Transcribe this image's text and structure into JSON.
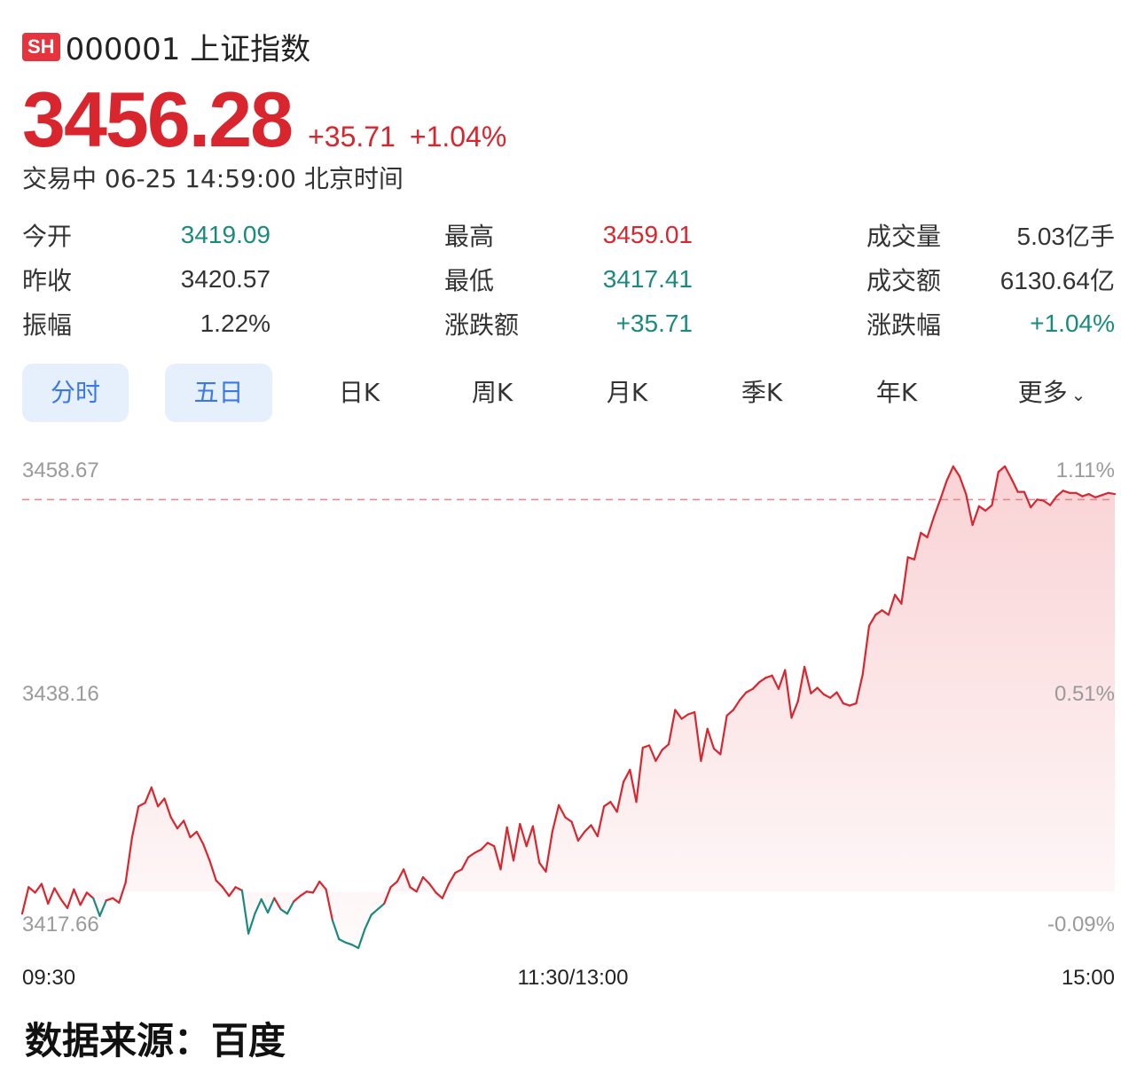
{
  "header": {
    "exchange_badge": "SH",
    "code_name": "000001 上证指数"
  },
  "quote": {
    "price": "3456.28",
    "change": "+35.71",
    "change_pct": "+1.04%"
  },
  "status_line": "交易中 06-25 14:59:00 北京时间",
  "stats": [
    [
      {
        "label": "今开",
        "value": "3419.09",
        "tone": "down"
      },
      {
        "label": "最高",
        "value": "3459.01",
        "tone": "up"
      },
      {
        "label": "成交量",
        "value": "5.03亿手",
        "tone": "flat"
      }
    ],
    [
      {
        "label": "昨收",
        "value": "3420.57",
        "tone": "flat"
      },
      {
        "label": "最低",
        "value": "3417.41",
        "tone": "down"
      },
      {
        "label": "成交额",
        "value": "6130.64亿",
        "tone": "flat"
      }
    ],
    [
      {
        "label": "振幅",
        "value": "1.22%",
        "tone": "flat"
      },
      {
        "label": "涨跌额",
        "value": "+35.71",
        "tone": "down"
      },
      {
        "label": "涨跌幅",
        "value": "+1.04%",
        "tone": "down"
      }
    ]
  ],
  "tabs": [
    {
      "label": "分时",
      "active": true
    },
    {
      "label": "五日",
      "active": true
    },
    {
      "label": "日K",
      "active": false
    },
    {
      "label": "周K",
      "active": false
    },
    {
      "label": "月K",
      "active": false
    },
    {
      "label": "季K",
      "active": false
    },
    {
      "label": "年K",
      "active": false
    },
    {
      "label": "更多",
      "active": false
    }
  ],
  "colors": {
    "up": "#d9262e",
    "down": "#1a8a7e",
    "accent": "#3b77e6"
  },
  "chart_data": {
    "type": "line",
    "y_left_ticks": [
      "3458.67",
      "3438.16",
      "3417.66"
    ],
    "y_right_ticks": [
      "1.11%",
      "0.51%",
      "-0.09%"
    ],
    "x_ticks": [
      "09:30",
      "11:30/13:00",
      "15:00"
    ],
    "ylim": [
      3417.66,
      3458.67
    ],
    "prev_close": 3420.57,
    "reference_line": 3456.0,
    "series": [
      {
        "values": [
          3418.6,
          3421.0,
          3420.5,
          3421.3,
          3419.5,
          3420.9,
          3419.9,
          3419.1,
          3420.8,
          3419.4,
          3420.5,
          3420.0,
          3418.4,
          3419.8,
          3420.0,
          3419.6,
          3421.4,
          3425.5,
          3428.3,
          3428.6,
          3430.0,
          3428.3,
          3429.0,
          3427.3,
          3426.3,
          3427.0,
          3425.5,
          3426.0,
          3424.9,
          3423.4,
          3421.6,
          3421.0,
          3420.2,
          3421.0,
          3420.7,
          3416.8,
          3418.6,
          3419.9,
          3418.7,
          3420.0,
          3419.0,
          3418.6,
          3419.7,
          3420.2,
          3420.6,
          3420.5,
          3421.5,
          3420.8,
          3418.0,
          3416.3,
          3416.0,
          3415.8,
          3415.5,
          3417.2,
          3418.5,
          3419.0,
          3419.5,
          3421.0,
          3421.5,
          3422.6,
          3421.0,
          3420.6,
          3421.9,
          3421.3,
          3420.5,
          3420.0,
          3421.3,
          3422.3,
          3422.6,
          3423.7,
          3424.1,
          3424.4,
          3425.0,
          3424.7,
          3422.6,
          3426.4,
          3423.4,
          3426.7,
          3424.7,
          3426.5,
          3423.2,
          3422.4,
          3426.0,
          3428.4,
          3427.3,
          3426.9,
          3425.2,
          3426.0,
          3426.6,
          3425.6,
          3428.3,
          3428.7,
          3427.8,
          3430.5,
          3431.6,
          3428.7,
          3433.6,
          3433.8,
          3432.4,
          3433.4,
          3433.9,
          3437.0,
          3436.2,
          3436.6,
          3436.8,
          3432.4,
          3435.3,
          3433.5,
          3433.0,
          3436.5,
          3437.0,
          3437.9,
          3438.6,
          3438.9,
          3439.5,
          3439.9,
          3440.1,
          3438.9,
          3440.6,
          3436.3,
          3437.8,
          3440.9,
          3438.5,
          3439.0,
          3438.4,
          3438.1,
          3438.6,
          3437.6,
          3437.4,
          3437.6,
          3440.2,
          3444.6,
          3445.6,
          3446.0,
          3445.6,
          3447.4,
          3446.6,
          3450.8,
          3450.6,
          3453.0,
          3452.6,
          3454.4,
          3456.0,
          3457.7,
          3459.0,
          3458.1,
          3456.5,
          3453.7,
          3455.4,
          3455.0,
          3455.5,
          3458.5,
          3459.0,
          3457.9,
          3456.7,
          3456.7,
          3455.3,
          3456.0,
          3455.9,
          3455.5,
          3456.3,
          3456.8,
          3456.6,
          3456.6,
          3456.3,
          3456.5,
          3456.2,
          3456.4,
          3456.6,
          3456.5
        ]
      }
    ]
  },
  "footer": {
    "source": "数据来源：百度"
  }
}
